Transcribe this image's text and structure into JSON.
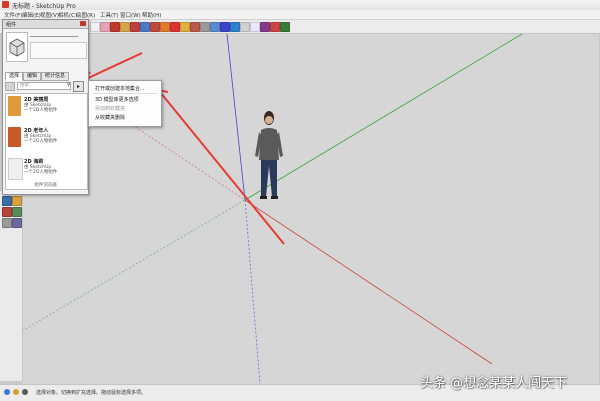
{
  "window": {
    "title": "无标题 - SketchUp Pro"
  },
  "menu": [
    "文件(F)",
    "编辑(E)",
    "视图(V)",
    "相机(C)",
    "绘图(R)",
    "工具(T)",
    "窗口(W)",
    "帮助(H)"
  ],
  "panel": {
    "title": "组件",
    "tabs": [
      "选择",
      "编辑",
      "统计信息"
    ],
    "search_placeholder": "搜索...",
    "details_symbol": "▸",
    "items": [
      {
        "name": "2D 美丽周",
        "line1": "由 SketchUp",
        "line2": "一个2D人物组件"
      },
      {
        "name": "2D 老年人",
        "line1": "由 SketchUp",
        "line2": "一个2D人物组件"
      },
      {
        "name": "2D 海莉",
        "line1": "由 SketchUp",
        "line2": "一个2D人物组件"
      }
    ],
    "footer": "组件浏览器"
  },
  "dropdown": {
    "items": [
      {
        "label": "打开或创建本地集合...",
        "enabled": true
      },
      {
        "label": "3D 模型库更多选项",
        "enabled": true
      },
      {
        "label": "添加到收藏夹",
        "enabled": false
      },
      {
        "label": "从收藏夹删除",
        "enabled": true
      }
    ]
  },
  "status": {
    "text": "选择对象。切换到扩充选择。拖动鼠标选择多项。"
  },
  "watermark": "头条 @想念某某人闯天下",
  "colors": {
    "axis_red": "#c8473f",
    "axis_green": "#39a33d",
    "axis_blue": "#3d46c8",
    "annotation_arrow": "#e63b35"
  },
  "icons": {
    "toolbar": [
      "select-icon",
      "eraser-icon",
      "paint-bucket-icon",
      "pencil-icon",
      "rectangle-icon",
      "circle-icon",
      "push-pull-icon",
      "move-icon",
      "rotate-icon",
      "scale-icon",
      "offset-icon",
      "tape-icon",
      "text-icon",
      "axes-icon",
      "orbit-icon",
      "pan-icon",
      "zoom-icon",
      "zoom-extents-icon",
      "warehouse-icon",
      "component-icon"
    ]
  }
}
